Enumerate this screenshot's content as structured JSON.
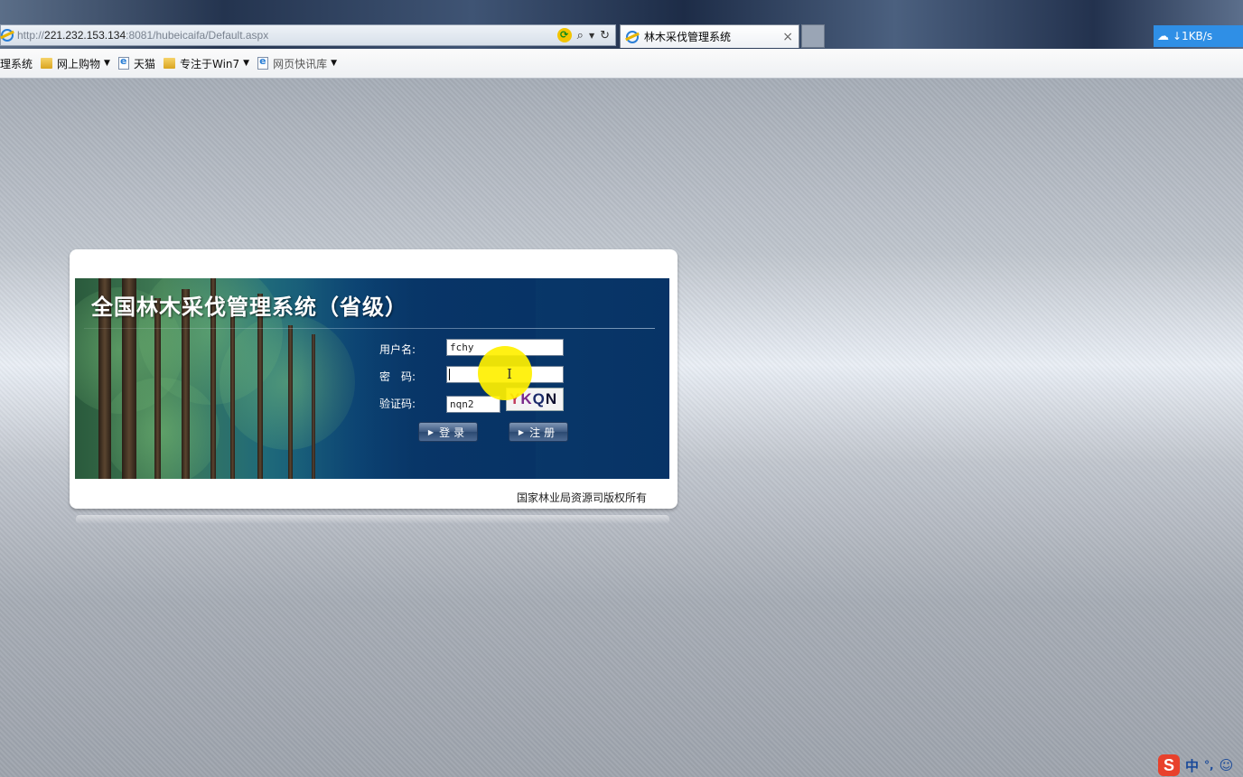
{
  "browser": {
    "url_prefix": "http://",
    "url_host": "221.232.153.134",
    "url_rest": ":8081/hubeicaifa/Default.aspx",
    "tab_title": "林木采伐管理系统",
    "tab_close": "×",
    "net_speed": "↓1KB/s",
    "favorites": [
      {
        "label": "理系统",
        "icon": "none",
        "dropdown": false
      },
      {
        "label": "网上购物",
        "icon": "folder-icon",
        "dropdown": true
      },
      {
        "label": "天猫",
        "icon": "page-icon",
        "dropdown": false
      },
      {
        "label": "专注于Win7",
        "icon": "folder-icon",
        "dropdown": true
      },
      {
        "label": "网页快讯库",
        "icon": "page-icon",
        "dropdown": true
      }
    ]
  },
  "login": {
    "title": "全国林木采伐管理系统（省级）",
    "username_label": "用户名:",
    "username_value": "fchy",
    "password_label": "密　码:",
    "password_value": "",
    "captcha_label": "验证码:",
    "captcha_value": "nqn2",
    "captcha_image_text": [
      "Y",
      "K",
      "Q",
      "N"
    ],
    "login_button": "登录",
    "register_button": "注册",
    "copyright": "国家林业局资源司版权所有"
  },
  "ime": {
    "mode": "中",
    "punct": "°,",
    "emoji": "☺"
  },
  "colors": {
    "banner_blue": "#073366",
    "button_blue": "#3d5a82",
    "cursor_highlight": "#fff000"
  }
}
